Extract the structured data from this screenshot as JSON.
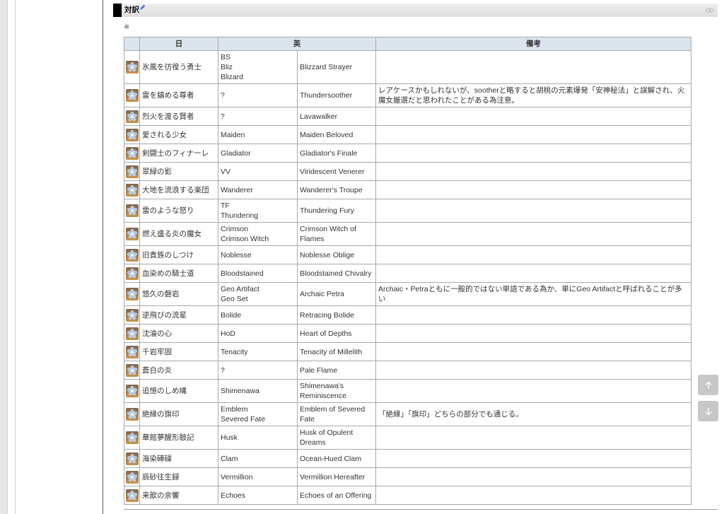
{
  "section": {
    "title": "対訳",
    "note_mark": "※"
  },
  "icons": {
    "section_edit": "pencil-icon",
    "section_anchor": "link-icon",
    "artifact": "artifact-icon",
    "scroll_up": "arrow-up-icon",
    "scroll_down": "arrow-down-icon"
  },
  "colors": {
    "header_bg": "#dbe4ec",
    "table_border": "#a9a9a9",
    "text": "#333333",
    "section_bar_bg": "#e4e4e4",
    "section_marker": "#000000",
    "edit_icon": "#3b6fc9",
    "scroll_button_bg": "#c7c7c7"
  },
  "table": {
    "headers": {
      "ja": "日",
      "en": "英",
      "note": "備考"
    },
    "rows": [
      {
        "ja": "氷風を彷徨う勇士",
        "abbr": [
          "BS",
          "Bliz",
          "Blizard"
        ],
        "en": "Blizzard Strayer"
      },
      {
        "ja": "雷を鎮める尊者",
        "abbr": [
          "?"
        ],
        "en": "Thundersoother",
        "note": "レアケースかもしれないが、sootherと略すると胡桃の元素爆発「安神秘法」と誤解され、火魔女厳選だと思われたことがある為注意。"
      },
      {
        "ja": "烈火を渡る賢者",
        "abbr": [
          "?"
        ],
        "en": "Lavawalker"
      },
      {
        "ja": "愛される少女",
        "abbr": [
          "Maiden"
        ],
        "en": "Maiden Beloved"
      },
      {
        "ja": "剣闘士のフィナーレ",
        "abbr": [
          "Gladiator"
        ],
        "en": "Gladiator's Finale"
      },
      {
        "ja": "翠緑の影",
        "abbr": [
          "VV"
        ],
        "en": "Viridescent Venerer"
      },
      {
        "ja": "大地を流浪する楽団",
        "abbr": [
          "Wanderer"
        ],
        "en": "Wanderer's Troupe"
      },
      {
        "ja": "雷のような怒り",
        "abbr": [
          "TF",
          "Thundering"
        ],
        "en": "Thundering Fury"
      },
      {
        "ja": "燃え盛る炎の魔女",
        "abbr": [
          "Crimson",
          "Crimson Witch"
        ],
        "en": "Crimson Witch of Flames"
      },
      {
        "ja": "旧貴族のしつけ",
        "abbr": [
          "Noblesse"
        ],
        "en": "Noblesse Oblige"
      },
      {
        "ja": "血染めの騎士道",
        "abbr": [
          "Bloodstained"
        ],
        "en": "Bloodstained Chivalry"
      },
      {
        "ja": "悠久の磐岩",
        "abbr": [
          "Geo Artifact",
          "Geo Set"
        ],
        "en": "Archaic Petra",
        "note": "Archaic・Petraともに一般的ではない単語である為か、単にGeo Artifactと呼ばれることが多い"
      },
      {
        "ja": "逆飛びの流星",
        "abbr": [
          "Bolide"
        ],
        "en": "Retracing Bolide"
      },
      {
        "ja": "沈淪の心",
        "abbr": [
          "HoD"
        ],
        "en": "Heart of Depths"
      },
      {
        "ja": "千岩牢固",
        "abbr": [
          "Tenacity"
        ],
        "en": "Tenacity of Millelith"
      },
      {
        "ja": "蒼白の炎",
        "abbr": [
          "?"
        ],
        "en": "Pale Flame"
      },
      {
        "ja": "追憶のしめ縄",
        "abbr": [
          "Shimenawa"
        ],
        "en": "Shimenawa's Reminiscence"
      },
      {
        "ja": "絶縁の旗印",
        "abbr": [
          "Emblem",
          "Severed Fate"
        ],
        "en": "Emblem of Severed Fate",
        "note": "「絶縁」「旗印」どちらの部分でも通じる。"
      },
      {
        "ja": "華館夢醒形骸記",
        "abbr": [
          "Husk"
        ],
        "en": "Husk of Opulent Dreams"
      },
      {
        "ja": "海染硨磲",
        "abbr": [
          "Clam"
        ],
        "en": "Ocean-Hued Clam"
      },
      {
        "ja": "辰砂往生録",
        "abbr": [
          "Vermillion"
        ],
        "en": "Vermillion Hereafter"
      },
      {
        "ja": "来歆の余響",
        "abbr": [
          "Echoes"
        ],
        "en": "Echoes of an Offering"
      }
    ]
  }
}
